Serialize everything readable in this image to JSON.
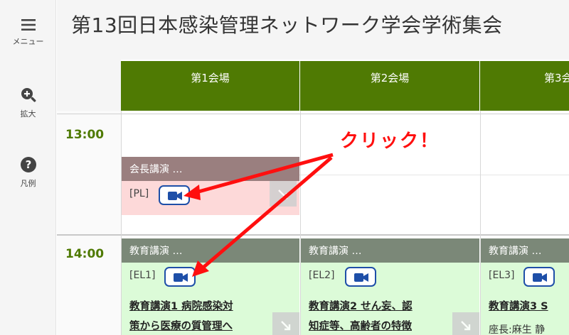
{
  "sidebar": {
    "menu_label": "メニュー",
    "zoom_label": "拡大",
    "legend_label": "凡例"
  },
  "header": {
    "title": "第13回日本感染管理ネットワーク学会学術集会"
  },
  "rooms": [
    {
      "label": "第1会場"
    },
    {
      "label": "第2会場"
    },
    {
      "label": "第3会場"
    }
  ],
  "times": [
    "13:00",
    "14:00"
  ],
  "sessions": {
    "pl": {
      "category": "会長講演 …",
      "code": "[PL]"
    },
    "el1": {
      "category": "教育講演 …",
      "code": "[EL1]",
      "title_line1": "教育講演1 病院感染対",
      "title_line2": "策から医療の質管理へ"
    },
    "el2": {
      "category": "教育講演 …",
      "code": "[EL2]",
      "title_line1": "教育講演2 せん妄、認",
      "title_line2": "知症等、高齢者の特徴"
    },
    "el3": {
      "category": "教育講演 …",
      "code": "[EL3]",
      "title_line1": "教育講演3 S",
      "chair": "座長:麻生 静"
    }
  },
  "annotation": {
    "text": "クリック！"
  },
  "colors": {
    "accent_green": "#4f7a03",
    "pl_header": "#9a7f7f",
    "pl_body": "#fdd9d9",
    "el_header": "#7b8878",
    "el_body": "#dcfbd8",
    "camera_blue": "#1e4fa8",
    "annotation_red": "#ff0f0f"
  }
}
